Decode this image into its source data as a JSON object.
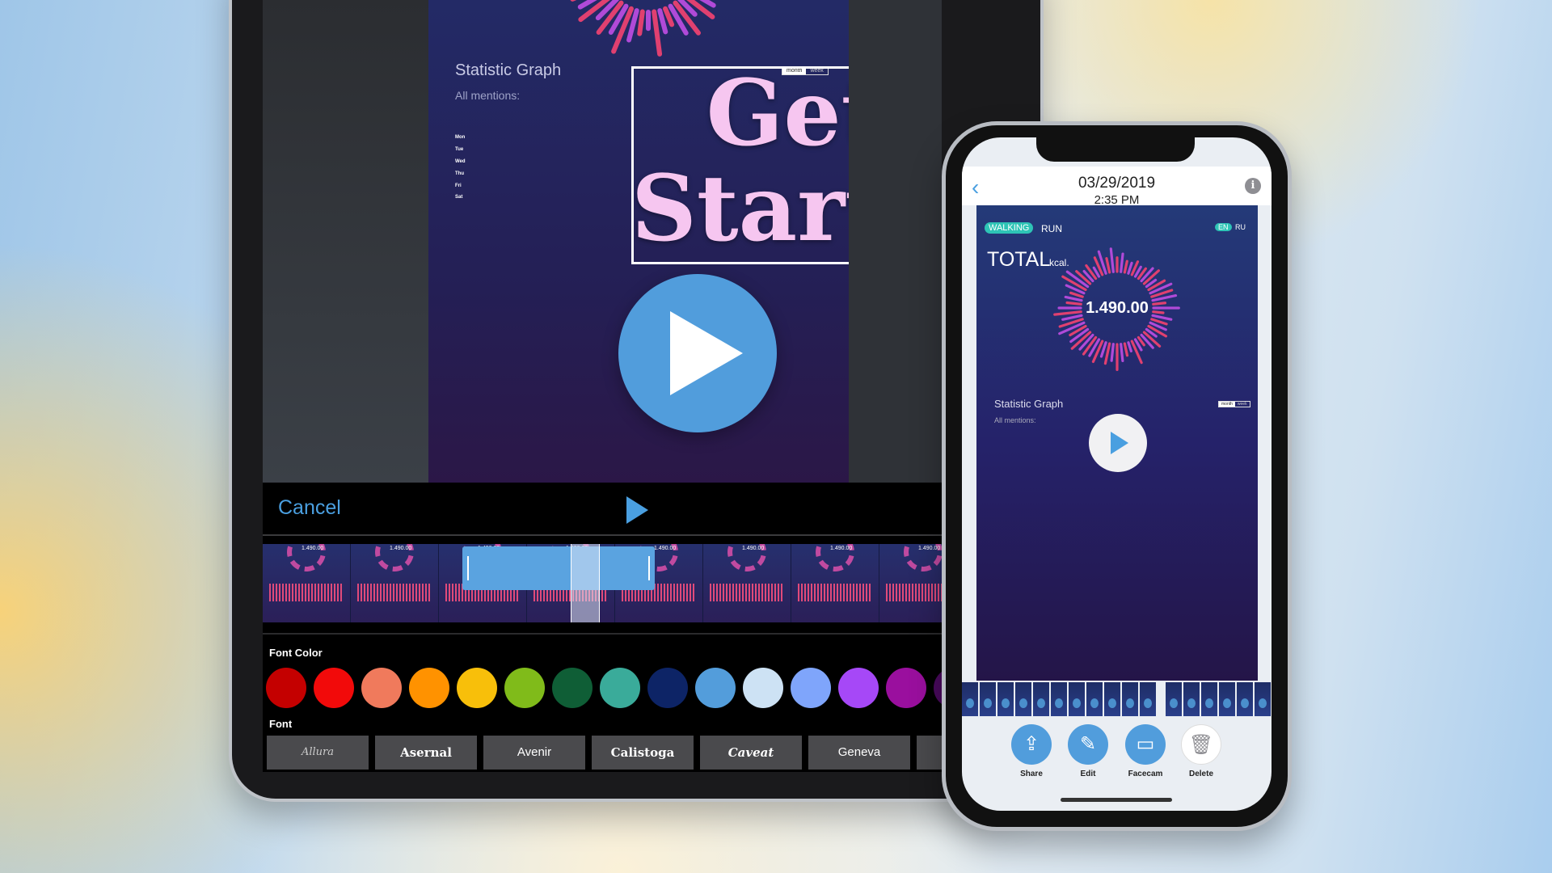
{
  "editor": {
    "canvas": {
      "stat_title": "Statistic Graph",
      "all_mentions": "All mentions:",
      "toggle": [
        "month",
        "week"
      ],
      "overlay_text": "Get Started",
      "day_labels": [
        "Mon",
        "Tue",
        "Wed",
        "Thu",
        "Fri",
        "Sat"
      ]
    },
    "controls": {
      "cancel_label": "Cancel"
    },
    "timeline": {
      "frame_value": "1.490.00",
      "frame_title": "Statistic Graph"
    },
    "font_color": {
      "label": "Font Color",
      "swatches": [
        "#c40000",
        "#f20a0a",
        "#f07a5c",
        "#ff9200",
        "#f8bf0a",
        "#80bb1a",
        "#0f5e36",
        "#3aab9a",
        "#0d2466",
        "#539ddb",
        "#cde2f4",
        "#7fa5fb",
        "#a648f7",
        "#9a0f9e",
        "#4a0a5e"
      ]
    },
    "font": {
      "label": "Font",
      "options": [
        "Allura",
        "Asernal",
        "Avenir",
        "Calistoga",
        "Caveat",
        "Geneva",
        "H"
      ]
    }
  },
  "phone": {
    "header": {
      "date": "03/29/2019",
      "time": "2:35 PM"
    },
    "video": {
      "tab_active": "WALKING",
      "tab_other": "RUN",
      "lang_active": "EN",
      "lang_other": "RU",
      "total": "TOTAL",
      "unit": "kcal.",
      "value": "1.490.00",
      "stat_title": "Statistic Graph",
      "all_mentions": "All mentions:",
      "toggle": [
        "month",
        "week"
      ]
    },
    "actions": [
      {
        "label": "Share",
        "icon": "share-icon"
      },
      {
        "label": "Edit",
        "icon": "edit-icon"
      },
      {
        "label": "Facecam",
        "icon": "facecam-icon"
      },
      {
        "label": "Delete",
        "icon": "trash-icon"
      }
    ]
  },
  "colors": {
    "accent": "#4a9fe0",
    "overlay_text": "#f6c6f0",
    "chart_bar_top": "#a84bd8",
    "chart_bar_bottom": "#f0405a"
  }
}
